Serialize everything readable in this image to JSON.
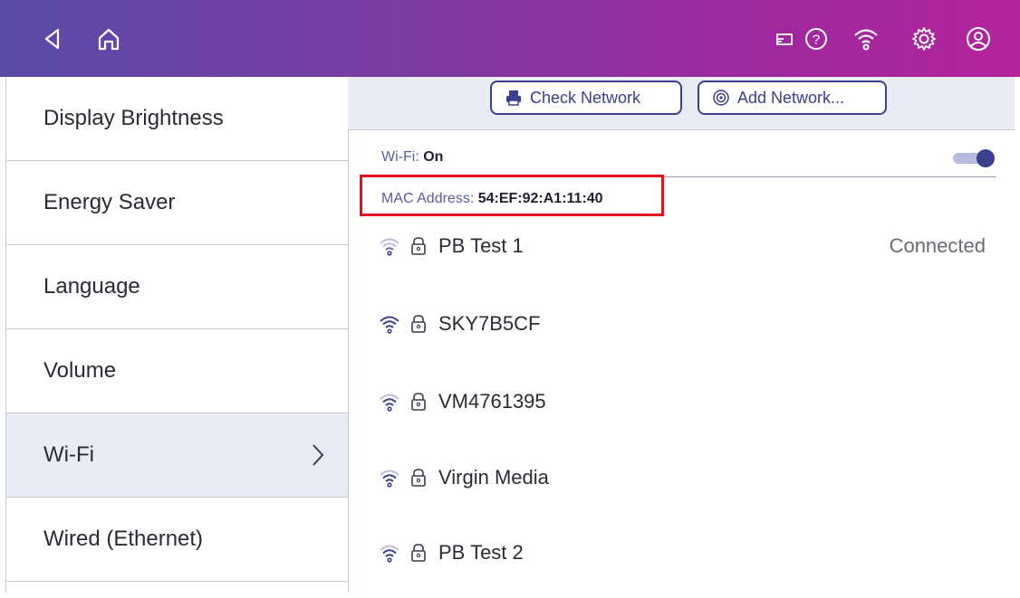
{
  "topbar": {
    "icons": [
      "back-icon",
      "home-icon",
      "cast-icon",
      "help-icon",
      "wifi-icon",
      "gear-icon",
      "account-icon"
    ]
  },
  "sidebar": {
    "items": [
      {
        "label": "Display Brightness"
      },
      {
        "label": "Energy Saver"
      },
      {
        "label": "Language"
      },
      {
        "label": "Volume"
      },
      {
        "label": "Wi-Fi"
      },
      {
        "label": "Wired (Ethernet)"
      }
    ],
    "active_index": 4
  },
  "toolbar": {
    "check_network": "Check Network",
    "add_network": "Add Network..."
  },
  "wifi": {
    "label": "Wi-Fi:",
    "value": "On",
    "enabled": true
  },
  "mac": {
    "label": "MAC Address:",
    "value": "54:EF:92:A1:11:40"
  },
  "networks": [
    {
      "name": "PB Test 1",
      "status": "Connected",
      "secured": true
    },
    {
      "name": "SKY7B5CF",
      "status": "",
      "secured": true
    },
    {
      "name": "VM4761395",
      "status": "",
      "secured": true
    },
    {
      "name": "Virgin Media",
      "status": "",
      "secured": true
    },
    {
      "name": "PB Test 2",
      "status": "",
      "secured": true
    }
  ],
  "colors": {
    "accent": "#3a3f90",
    "highlight_box": "#e0101e",
    "gradient_start": "#5a4aa6",
    "gradient_end": "#b2239b"
  }
}
